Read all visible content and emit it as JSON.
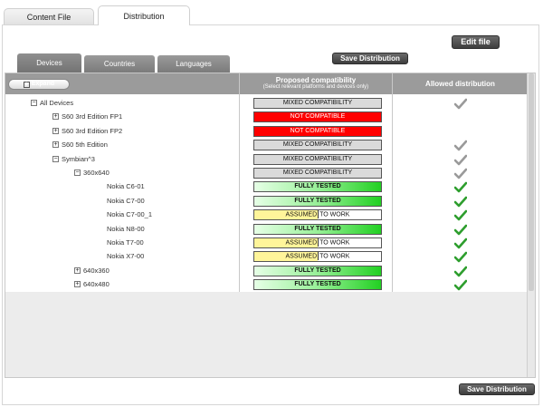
{
  "tabs": {
    "content_file": "Content File",
    "distribution": "Distribution"
  },
  "buttons": {
    "edit_file": "Edit file",
    "save_distribution": "Save Distribution",
    "expand": "Expand"
  },
  "subtabs": [
    "Devices",
    "Countries",
    "Languages"
  ],
  "columns": {
    "proposed": "Proposed compatibility",
    "proposed_hint": "(Select relevant platforms and devices only)",
    "allowed": "Allowed distribution"
  },
  "rows": [
    {
      "label": "All Devices",
      "toggle": "−",
      "status": "mixed",
      "status_text": "MIXED COMPATIBILITY",
      "check": "grey"
    },
    {
      "label": "S60 3rd Edition FP1",
      "toggle": "+",
      "status": "notc",
      "status_text": "NOT COMPATIBLE",
      "check": "none"
    },
    {
      "label": "S60 3rd Edition FP2",
      "toggle": "+",
      "status": "notc",
      "status_text": "NOT COMPATIBLE",
      "check": "none"
    },
    {
      "label": "S60 5th Edition",
      "toggle": "+",
      "status": "mixed",
      "status_text": "MIXED COMPATIBILITY",
      "check": "grey"
    },
    {
      "label": "Symbian^3",
      "toggle": "−",
      "status": "mixed",
      "status_text": "MIXED COMPATIBILITY",
      "check": "grey"
    },
    {
      "label": "360x640",
      "toggle": "−",
      "status": "mixed",
      "status_text": "MIXED COMPATIBILITY",
      "check": "grey"
    },
    {
      "label": "Nokia C6-01",
      "toggle": "",
      "status": "tested",
      "status_text": "FULLY TESTED",
      "check": "green"
    },
    {
      "label": "Nokia C7-00",
      "toggle": "",
      "status": "tested",
      "status_text": "FULLY TESTED",
      "check": "green"
    },
    {
      "label": "Nokia C7-00_1",
      "toggle": "",
      "status": "assumed",
      "status_text_a": "ASSUMED",
      "status_text_b": "TO WORK",
      "check": "green"
    },
    {
      "label": "Nokia N8-00",
      "toggle": "",
      "status": "tested",
      "status_text": "FULLY TESTED",
      "check": "green"
    },
    {
      "label": "Nokia T7-00",
      "toggle": "",
      "status": "assumed",
      "status_text_a": "ASSUMED",
      "status_text_b": "TO WORK",
      "check": "green"
    },
    {
      "label": "Nokia X7-00",
      "toggle": "",
      "status": "assumed",
      "status_text_a": "ASSUMED",
      "status_text_b": "TO WORK",
      "check": "green"
    },
    {
      "label": "640x360",
      "toggle": "+",
      "status": "tested",
      "status_text": "FULLY TESTED",
      "check": "green"
    },
    {
      "label": "640x480",
      "toggle": "+",
      "status": "tested",
      "status_text": "FULLY TESTED",
      "check": "green"
    }
  ],
  "colors": {
    "not_compatible": "#ff0000",
    "fully_tested": "#22d022",
    "assumed": "#fff59a",
    "check_green": "#2e9e2e",
    "check_grey": "#9a9a9a"
  }
}
